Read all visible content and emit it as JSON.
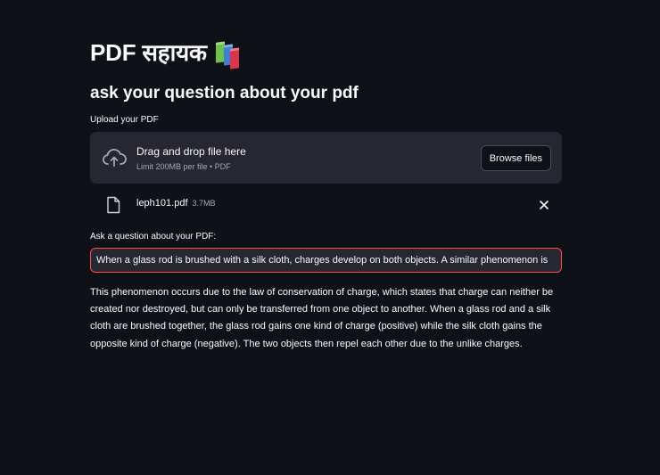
{
  "app": {
    "title": "PDF सहायक",
    "title_icon": "books-icon"
  },
  "header": {
    "subtitle": "ask your question about your pdf"
  },
  "uploader": {
    "label": "Upload your PDF",
    "drop_text": "Drag and drop file here",
    "limit_text": "Limit 200MB per file • PDF",
    "browse_label": "Browse files",
    "icon": "cloud-upload-icon"
  },
  "uploaded_file": {
    "name": "leph101.pdf",
    "size": "3.7MB",
    "icon": "file-icon",
    "remove_icon": "close-icon"
  },
  "question": {
    "label": "Ask a question about your PDF:",
    "value": "When a glass rod is brushed with a silk cloth, charges develop on both objects. A similar phenomenon is",
    "border_color": "#ff4b4b"
  },
  "answer": {
    "text": "This phenomenon occurs due to the law of conservation of charge, which states that charge can neither be created nor destroyed, but can only be transferred from one object to another. When a glass rod and a silk cloth are brushed together, the glass rod gains one kind of charge (positive) while the silk cloth gains the opposite kind of charge (negative). The two objects then repel each other due to the unlike charges."
  },
  "colors": {
    "background": "#0e1117",
    "panel": "#262730",
    "text": "#fafafa",
    "muted": "#a3a8b4",
    "accent": "#ff4b4b"
  }
}
